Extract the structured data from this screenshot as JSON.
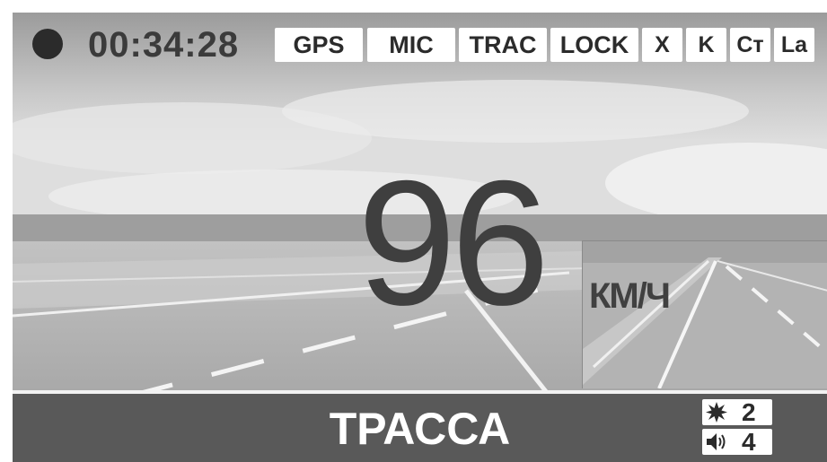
{
  "status": {
    "recording_indicator": "recording-dot",
    "elapsed_time": "00:34:28",
    "badges": [
      "GPS",
      "MIC",
      "TRAC",
      "LOCK",
      "X",
      "K",
      "Cт",
      "La"
    ]
  },
  "speed": {
    "value": "96",
    "unit": "КМ/Ч"
  },
  "mode": {
    "label": "ТРАССА"
  },
  "counters": {
    "alerts": {
      "icon": "burst-icon",
      "value": "2"
    },
    "volume": {
      "icon": "speaker-icon",
      "value": "4"
    }
  },
  "colors": {
    "bottom_bar": "#595959",
    "badge_background": "#ffffff",
    "text_dark": "#2b2b2b"
  }
}
